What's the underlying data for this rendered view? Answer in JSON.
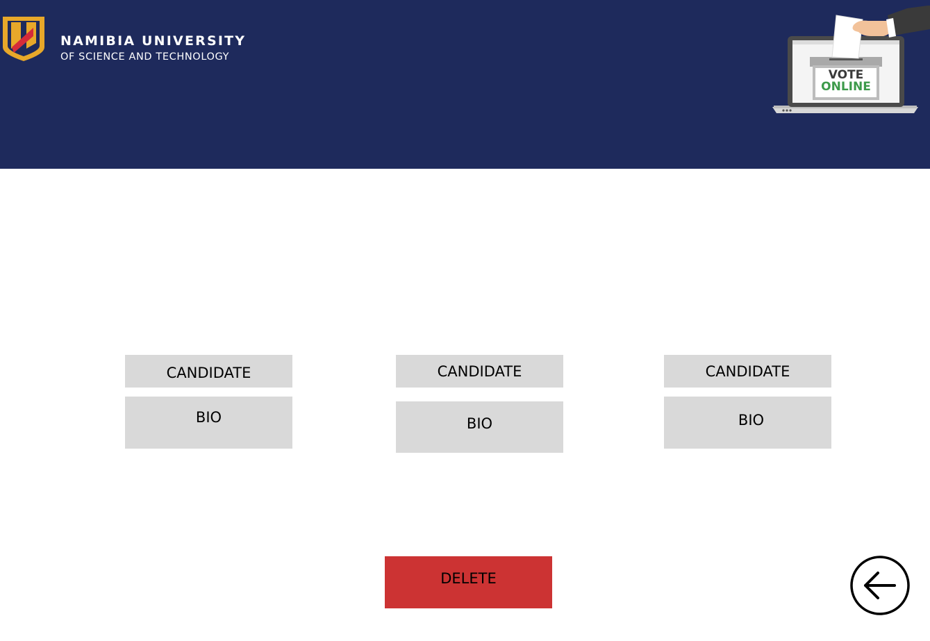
{
  "header": {
    "logo": {
      "line1": "NAMIBIA UNIVERSITY",
      "line2": "OF SCIENCE AND TECHNOLOGY"
    },
    "illustration": {
      "line1": "VOTE",
      "line2": "ONLINE"
    }
  },
  "candidates": [
    {
      "candidate_label": "CANDIDATE",
      "bio_label": "BIO"
    },
    {
      "candidate_label": "CANDIDATE",
      "bio_label": "BIO"
    },
    {
      "candidate_label": "CANDIDATE",
      "bio_label": "BIO"
    }
  ],
  "actions": {
    "delete_label": "DELETE",
    "back_icon": "arrow-left-circle-icon"
  },
  "colors": {
    "header_bg": "#1e2a5c",
    "card_bg": "#d9d9d9",
    "delete_bg": "#cc3333",
    "logo_gold": "#e8a82a",
    "logo_red": "#d52b3a",
    "vote_green": "#3c9a4a"
  }
}
